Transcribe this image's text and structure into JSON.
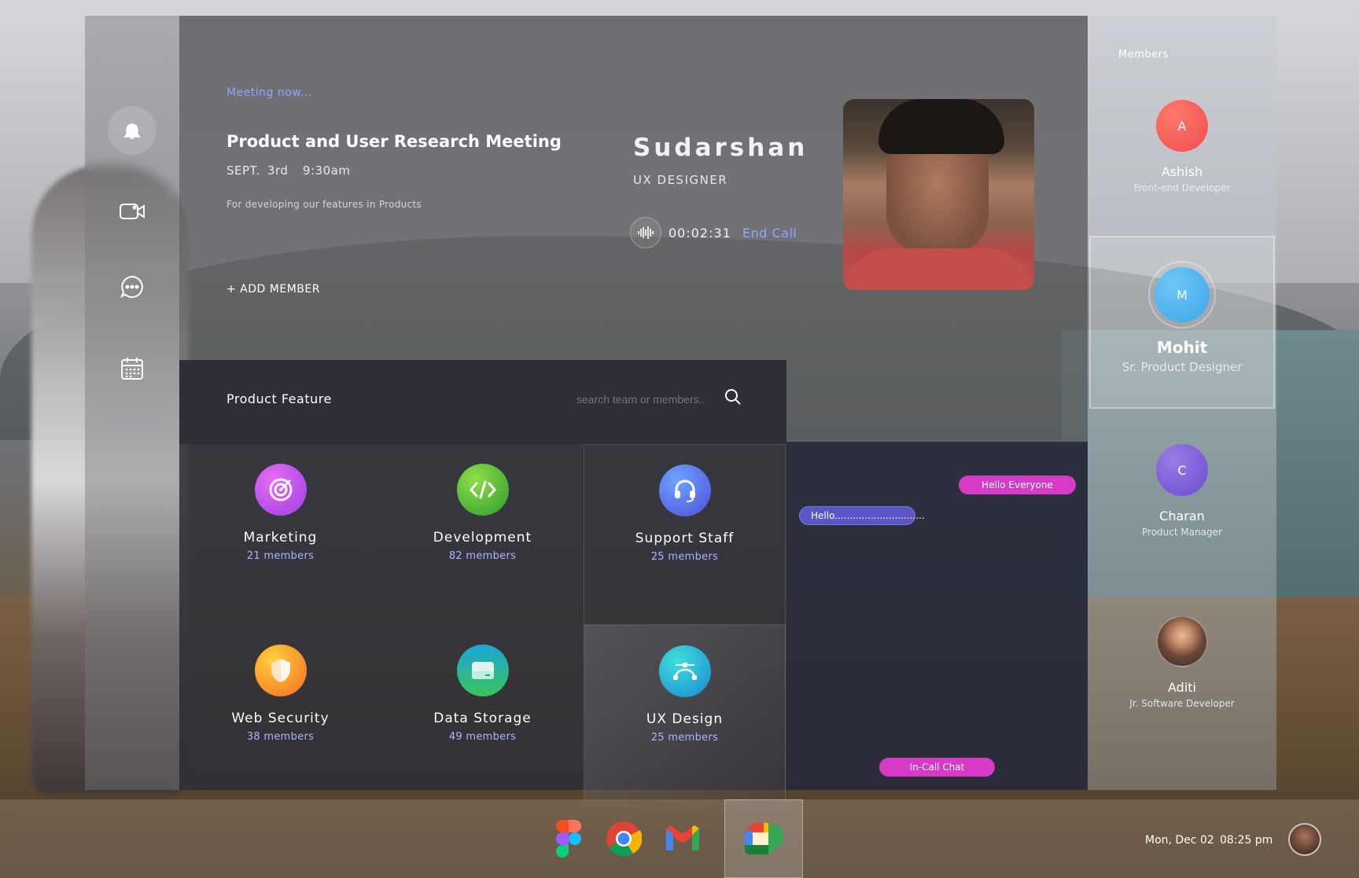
{
  "nav": {
    "items": [
      {
        "icon": "bell-icon",
        "active": true
      },
      {
        "icon": "video-camera-icon",
        "active": false
      },
      {
        "icon": "chat-icon",
        "active": false
      },
      {
        "icon": "calendar-icon",
        "active": false
      }
    ]
  },
  "meeting": {
    "status": "Meeting now...",
    "title": "Product and User Research Meeting",
    "date": "SEPT. 3rd  9:30am",
    "description": "For developing our features in Products",
    "add_member_label": "+ ADD MEMBER"
  },
  "call": {
    "host_name": "Sudarshan",
    "host_role": "UX DESIGNER",
    "timer": "00:02:31",
    "end_call_label": "End Call"
  },
  "product_feature": {
    "title": "Product Feature",
    "search_placeholder": "search team or members..",
    "teams": [
      {
        "name": "Marketing",
        "count": "21 members",
        "icon": "target-icon",
        "color": "#c63ee6"
      },
      {
        "name": "Development",
        "count": "82 members",
        "icon": "code-icon",
        "color": "#4fb62f"
      },
      {
        "name": "Support Staff",
        "count": "25 members",
        "icon": "headset-icon",
        "color": "#4d6cf0"
      },
      {
        "name": "Web Security",
        "count": "38 members",
        "icon": "shield-icon",
        "color": "#f59f1a"
      },
      {
        "name": "Data Storage",
        "count": "49 members",
        "icon": "storage-icon",
        "color": "#22b58f"
      },
      {
        "name": "UX Design",
        "count": "25 members",
        "icon": "vector-pen-icon",
        "color": "#1fb2d6"
      }
    ]
  },
  "chat": {
    "messages": [
      {
        "text": "Hello Everyone",
        "side": "right"
      },
      {
        "text": "Hello..............................",
        "side": "left"
      }
    ],
    "tab_label": "In-Call Chat"
  },
  "members": {
    "title": "Members",
    "list": [
      {
        "initial": "A",
        "name": "Ashish",
        "role": "Front-end Developer",
        "color": "#f0595a"
      },
      {
        "initial": "M",
        "name": "Mohit",
        "role": "Sr. Product Designer",
        "color": "#4ab4ee",
        "selected": true
      },
      {
        "initial": "C",
        "name": "Charan",
        "role": "Product Manager",
        "color": "#7b5cd6"
      },
      {
        "initial": "",
        "name": "Aditi",
        "role": "Jr. Software Developer",
        "color": "#7a5a48"
      }
    ]
  },
  "taskbar": {
    "apps": [
      "figma-icon",
      "chrome-icon",
      "gmail-icon",
      "google-meet-icon"
    ],
    "active_app": "google-meet-icon",
    "date": "Mon, Dec 02",
    "time": "08:25 pm"
  }
}
